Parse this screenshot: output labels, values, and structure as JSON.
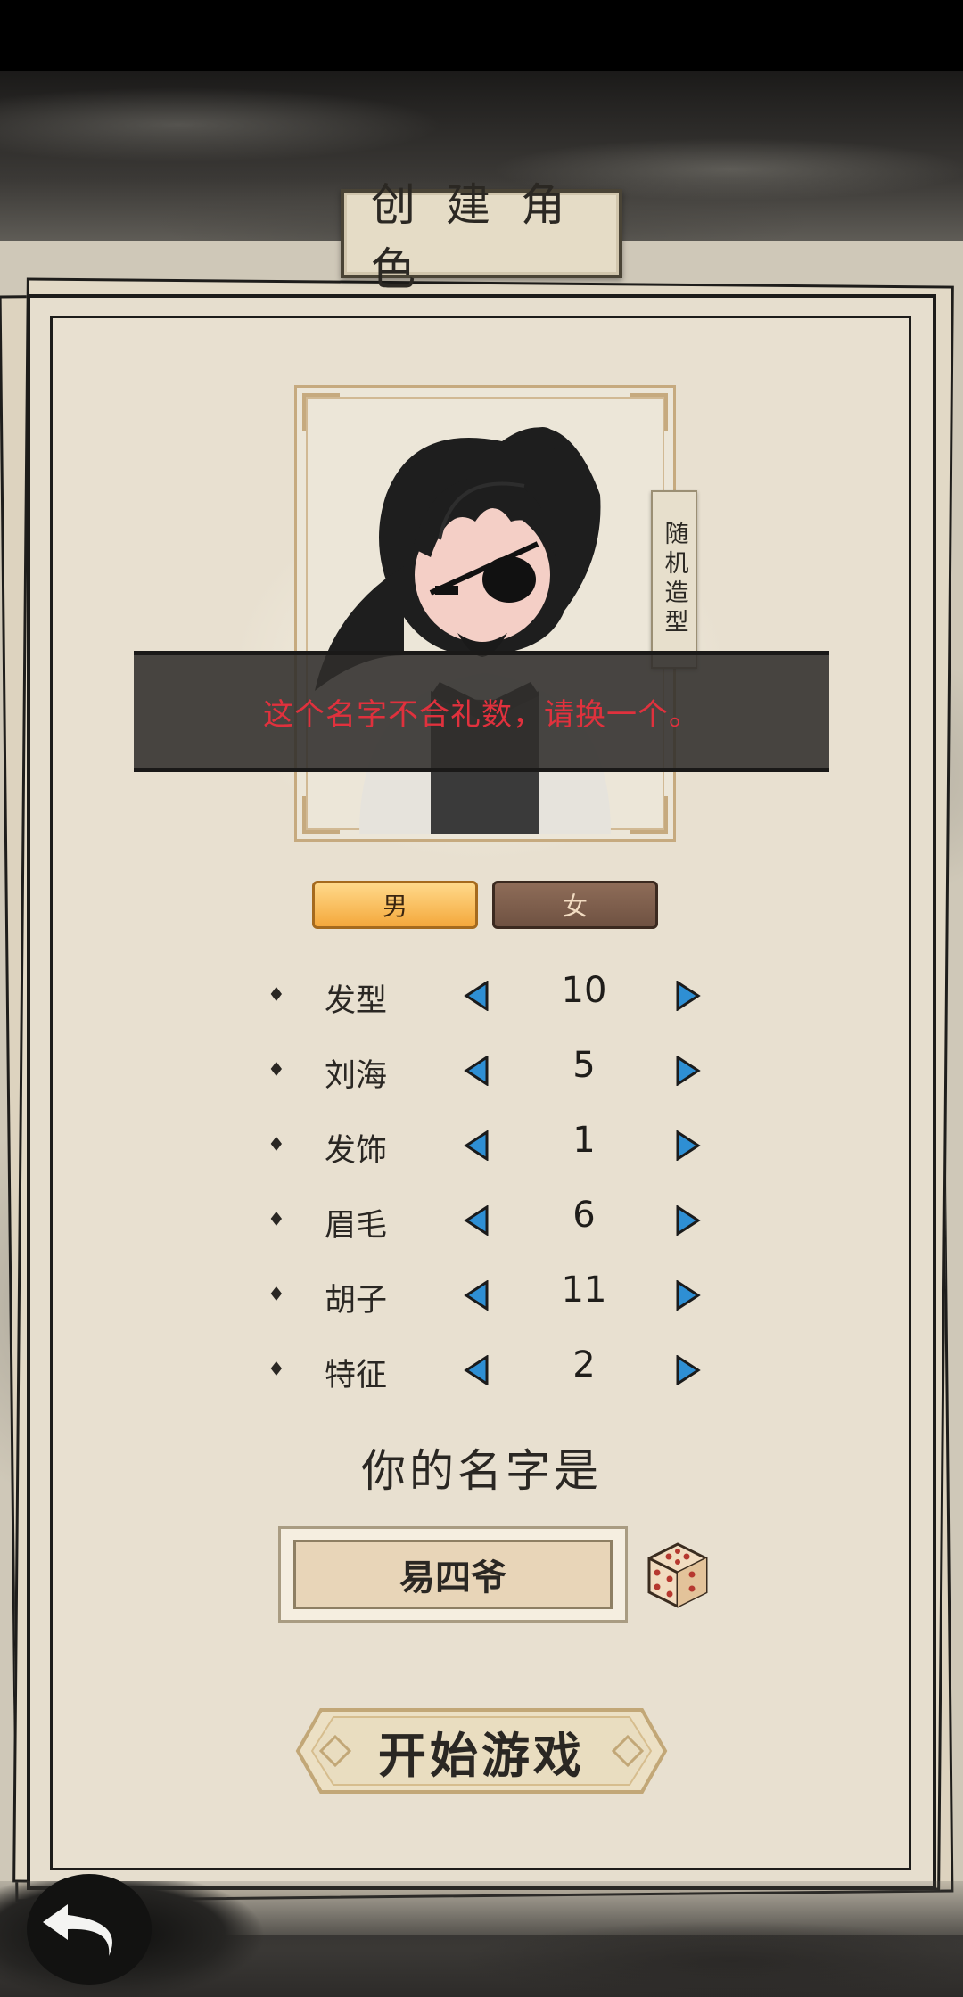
{
  "screen": {
    "title": "创建角色",
    "random_style_label": "随机造型",
    "toast_message": "这个名字不合礼数，请换一个。"
  },
  "gender": {
    "options": [
      {
        "label": "男",
        "selected": true
      },
      {
        "label": "女",
        "selected": false
      }
    ]
  },
  "attributes": [
    {
      "label": "发型",
      "value": "10"
    },
    {
      "label": "刘海",
      "value": "5"
    },
    {
      "label": "发饰",
      "value": "1"
    },
    {
      "label": "眉毛",
      "value": "6"
    },
    {
      "label": "胡子",
      "value": "11"
    },
    {
      "label": "特征",
      "value": "2"
    }
  ],
  "name_section": {
    "heading": "你的名字是",
    "value": "易四爷"
  },
  "start_button_label": "开始游戏",
  "icons": {
    "attribute_bullet": "diamond-icon",
    "prev": "triangle-left-icon",
    "next": "triangle-right-icon",
    "randomize_name": "dice-icon",
    "back": "back-arrow-icon"
  },
  "colors": {
    "toast_text": "#e0313d",
    "male_selected": "#f4a83c",
    "female_unselected": "#6f5242",
    "arrow_blue": "#2e8fd4"
  }
}
